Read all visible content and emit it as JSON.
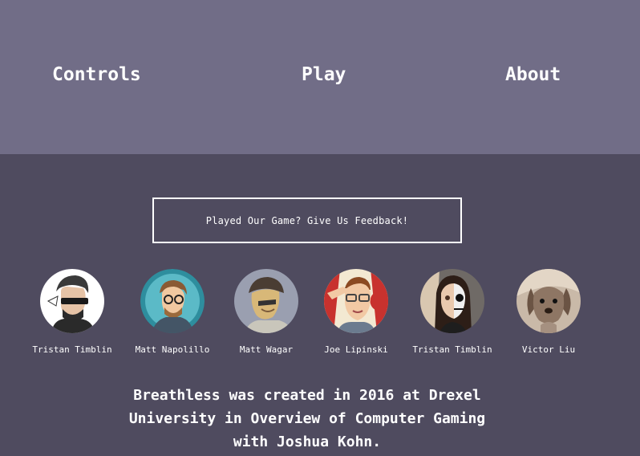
{
  "nav": {
    "controls": "Controls",
    "play": "Play",
    "about": "About"
  },
  "feedback": {
    "label": "Played Our Game? Give Us Feedback!"
  },
  "team": [
    {
      "name": "Tristan Timblin",
      "icon": "cartoon-man-sunglasses-avatar"
    },
    {
      "name": "Matt Napolillo",
      "icon": "cartoon-man-glasses-avatar"
    },
    {
      "name": "Matt Wagar",
      "icon": "cartoon-man-cap-avatar"
    },
    {
      "name": "Joe Lipinski",
      "icon": "man-saluting-photo-avatar"
    },
    {
      "name": "Tristan Timblin",
      "icon": "skull-facepaint-photo-avatar"
    },
    {
      "name": "Victor Liu",
      "icon": "dog-photo-avatar"
    }
  ],
  "credits": "Breathless was created in 2016 at Drexel University in Overview of Computer Gaming with Joshua Kohn.",
  "colors": {
    "nav_background": "#716d87",
    "page_background": "#4f4b5f",
    "text": "#ffffff"
  }
}
